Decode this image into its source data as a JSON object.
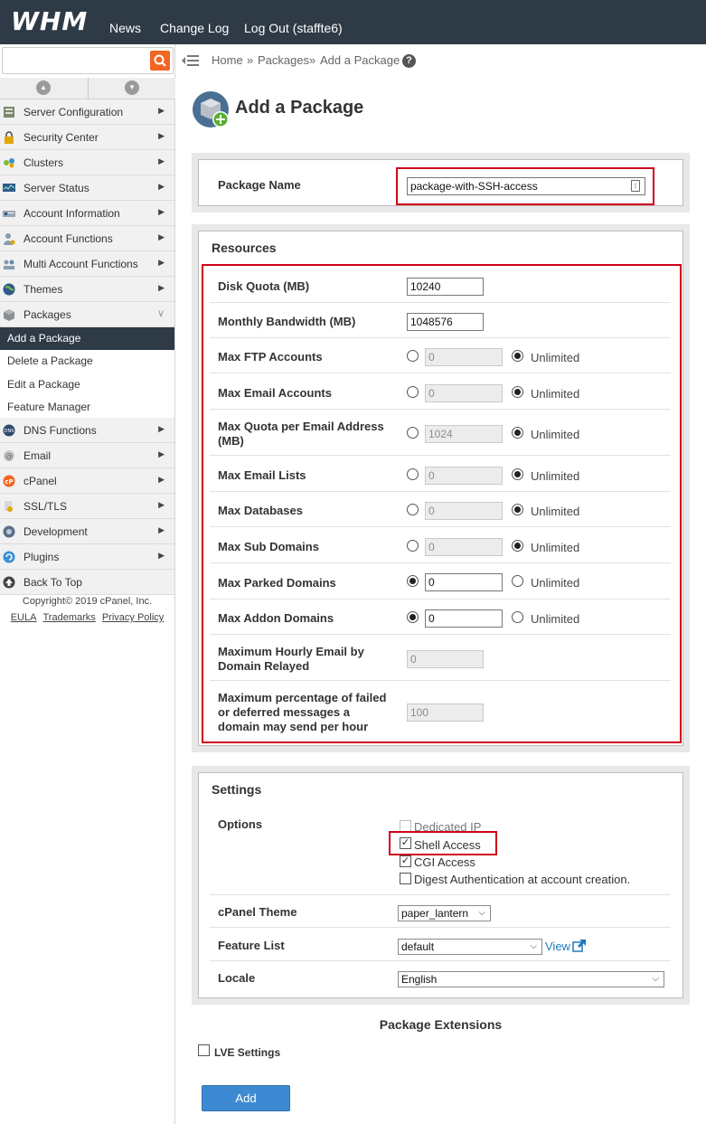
{
  "header": {
    "logo": "WHM",
    "links": [
      "News",
      "Change Log",
      "Log Out (staffte6)"
    ]
  },
  "search": {
    "placeholder": ""
  },
  "sidebar": {
    "items": [
      {
        "label": "Server Configuration",
        "icon": "server-config-icon"
      },
      {
        "label": "Security Center",
        "icon": "lock-icon"
      },
      {
        "label": "Clusters",
        "icon": "clusters-icon"
      },
      {
        "label": "Server Status",
        "icon": "monitor-icon"
      },
      {
        "label": "Account Information",
        "icon": "account-info-icon"
      },
      {
        "label": "Account Functions",
        "icon": "user-icon"
      },
      {
        "label": "Multi Account Functions",
        "icon": "multi-user-icon"
      },
      {
        "label": "Themes",
        "icon": "globe-icon"
      },
      {
        "label": "Packages",
        "icon": "package-icon"
      }
    ],
    "sub_items": [
      "Add a Package",
      "Delete a Package",
      "Edit a Package",
      "Feature Manager"
    ],
    "items_after": [
      {
        "label": "DNS Functions",
        "icon": "dns-icon"
      },
      {
        "label": "Email",
        "icon": "email-icon"
      },
      {
        "label": "cPanel",
        "icon": "cpanel-icon"
      },
      {
        "label": "SSL/TLS",
        "icon": "ssl-icon"
      },
      {
        "label": "Development",
        "icon": "development-icon"
      },
      {
        "label": "Plugins",
        "icon": "plugins-icon"
      },
      {
        "label": "Back To Top",
        "icon": "arrow-up-icon"
      }
    ],
    "copyright": "Copyright© 2019 cPanel, Inc.",
    "footer_links": [
      "EULA",
      "Trademarks",
      "Privacy Policy"
    ]
  },
  "breadcrumb": {
    "home": "Home",
    "sep": "»",
    "packages": "Packages",
    "current": "Add a Package",
    "help": "?"
  },
  "page": {
    "title": "Add a Package"
  },
  "package_name": {
    "label": "Package Name",
    "value": "package-with-SSH-access"
  },
  "resources": {
    "title": "Resources",
    "disk_quota": {
      "label": "Disk Quota (MB)",
      "value": "10240"
    },
    "bandwidth": {
      "label": "Monthly Bandwidth (MB)",
      "value": "1048576"
    },
    "unlimited_label": "Unlimited",
    "limited_rows": [
      {
        "label": "Max FTP Accounts",
        "value": "0",
        "unlimited": true
      },
      {
        "label": "Max Email Accounts",
        "value": "0",
        "unlimited": true
      },
      {
        "label": "Max Quota per Email Address (MB)",
        "value": "1024",
        "unlimited": true
      },
      {
        "label": "Max Email Lists",
        "value": "0",
        "unlimited": true
      },
      {
        "label": "Max Databases",
        "value": "0",
        "unlimited": true
      },
      {
        "label": "Max Sub Domains",
        "value": "0",
        "unlimited": true
      },
      {
        "label": "Max Parked Domains",
        "value": "0",
        "unlimited": false
      },
      {
        "label": "Max Addon Domains",
        "value": "0",
        "unlimited": false
      }
    ],
    "hourly_email": {
      "label": "Maximum Hourly Email by Domain Relayed",
      "value": "0"
    },
    "failed_pct": {
      "label": "Maximum percentage of failed or deferred messages a domain may send per hour",
      "value": "100"
    }
  },
  "settings": {
    "title": "Settings",
    "options_label": "Options",
    "options": [
      {
        "label": "Dedicated IP",
        "checked": false,
        "disabled": true
      },
      {
        "label": "Shell Access",
        "checked": true,
        "disabled": false
      },
      {
        "label": "CGI Access",
        "checked": true,
        "disabled": false
      },
      {
        "label": "Digest Authentication at account creation.",
        "checked": false,
        "disabled": false
      }
    ],
    "theme": {
      "label": "cPanel Theme",
      "value": "paper_lantern"
    },
    "feature_list": {
      "label": "Feature List",
      "value": "default",
      "view_link": "View"
    },
    "locale": {
      "label": "Locale",
      "value": "English"
    }
  },
  "extensions": {
    "title": "Package Extensions",
    "lve_label": "LVE Settings",
    "lve_checked": false
  },
  "actions": {
    "add_label": "Add"
  },
  "colors": {
    "header_bg": "#2e3a46",
    "accent_orange": "#f26522",
    "highlight_red": "#d0021b",
    "button_blue": "#3e8ad2",
    "link_blue": "#1d7abf"
  }
}
